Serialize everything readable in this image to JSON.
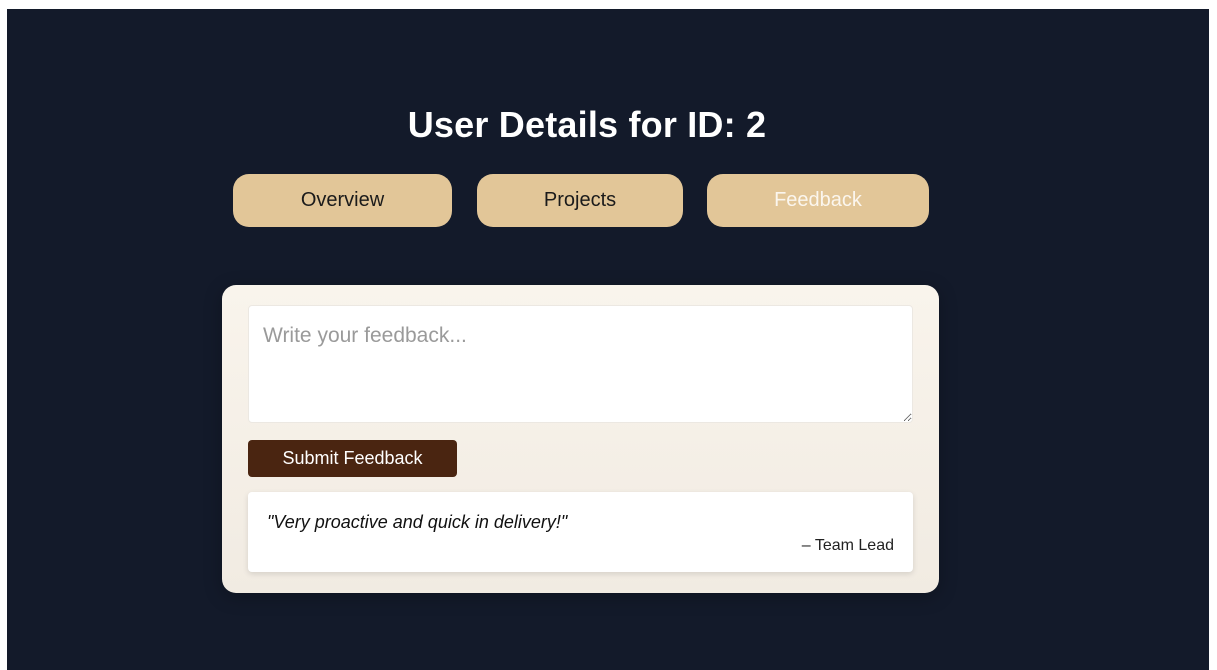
{
  "colors": {
    "background": "#131a2a",
    "tab": "#e2c698",
    "button": "#4a2511"
  },
  "header": {
    "title": "User Details for ID: 2"
  },
  "tabs": [
    {
      "label": "Overview",
      "active": false
    },
    {
      "label": "Projects",
      "active": false
    },
    {
      "label": "Feedback",
      "active": true
    }
  ],
  "feedback_form": {
    "value": "",
    "placeholder": "Write your feedback...",
    "submit_label": "Submit Feedback"
  },
  "feedback_list": [
    {
      "quote": "\"Very proactive and quick in delivery!\"",
      "author": "– Team Lead"
    }
  ]
}
